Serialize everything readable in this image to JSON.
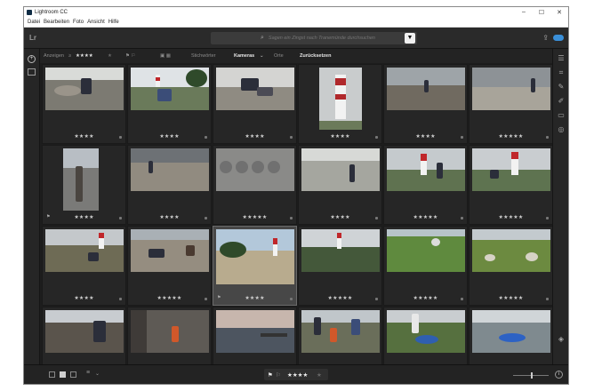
{
  "window": {
    "title": "Lightroom CC",
    "controls": {
      "minimize": "–",
      "maximize": "☐",
      "close": "✕"
    }
  },
  "menu": [
    "Datei",
    "Bearbeiten",
    "Foto",
    "Ansicht",
    "Hilfe"
  ],
  "topbar": {
    "logo": "Lr",
    "search_placeholder": "Sagen ein Zingst nach Tranemünde durchsuchen"
  },
  "filterbar": {
    "show_label": "Anzeigen",
    "rating_op": "≥",
    "rating_filled": "★★★★",
    "rating_empty": "★",
    "keywords_label": "Stichwörter",
    "cameras_label": "Kameras",
    "places_label": "Orte",
    "reset_label": "Zurücksetzen"
  },
  "rows": [
    [
      "★★★★",
      "★★★★",
      "★★★★",
      "★★★★",
      "★★★★",
      "★★★★★"
    ],
    [
      "★★★★",
      "★★★★",
      "★★★★★",
      "★★★★",
      "★★★★★",
      "★★★★★"
    ],
    [
      "★★★★",
      "★★★★★",
      "★★★★",
      "★★★★★",
      "★★★★★",
      "★★★★★"
    ],
    [
      "★★★★",
      "★★★★",
      "★★★★",
      "★★★★",
      "★★★★",
      "★★★★"
    ]
  ],
  "bottombar": {
    "flag_picked": "⚑",
    "flag_open": "⚐",
    "rating_filled": "★★★★",
    "rating_empty": "★"
  },
  "colors": {
    "accent_blue": "#3a8fd8",
    "lighthouse_red": "#c0262a",
    "panel_bg": "#1d1d1d"
  }
}
